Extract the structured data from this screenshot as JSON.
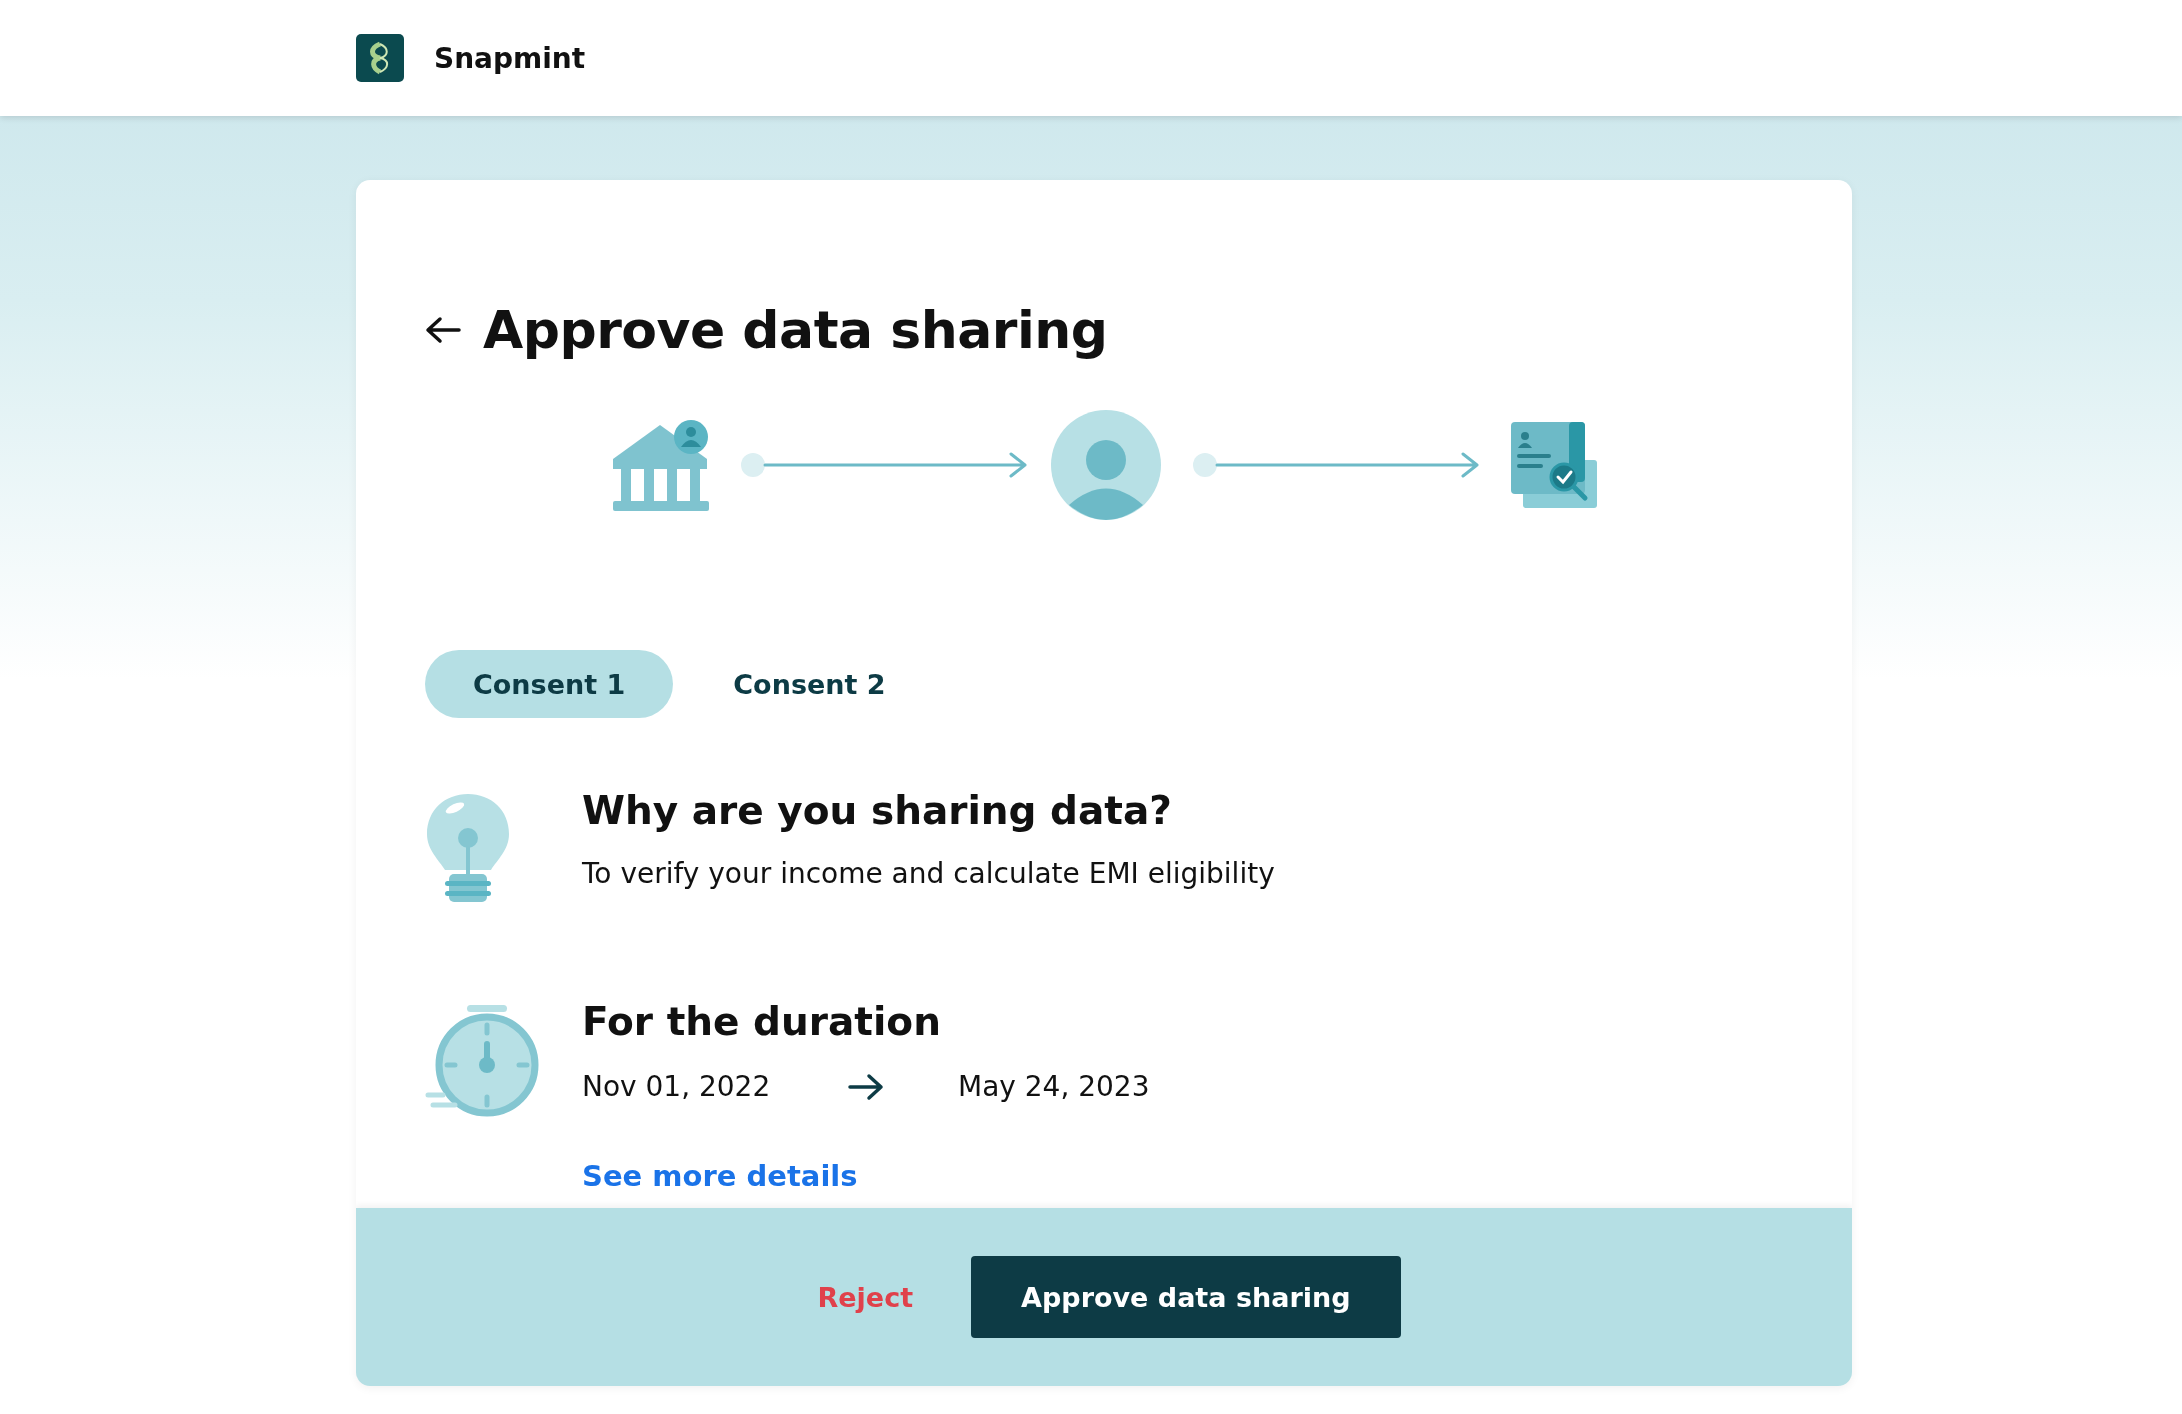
{
  "header": {
    "brand": "Snapmint"
  },
  "title": "Approve data sharing",
  "tabs": [
    {
      "label": "Consent 1",
      "selected": true
    },
    {
      "label": "Consent 2",
      "selected": false
    }
  ],
  "sections": [
    {
      "kind": "purpose",
      "heading": "Why are you sharing data?",
      "text": "To verify your income and calculate EMI eligibility"
    },
    {
      "kind": "duration",
      "heading": "For the duration",
      "from": "Nov 01, 2022",
      "to": "May 24, 2023"
    }
  ],
  "link": "See more details",
  "actions": {
    "reject": "Reject",
    "approve": "Approve data sharing"
  }
}
